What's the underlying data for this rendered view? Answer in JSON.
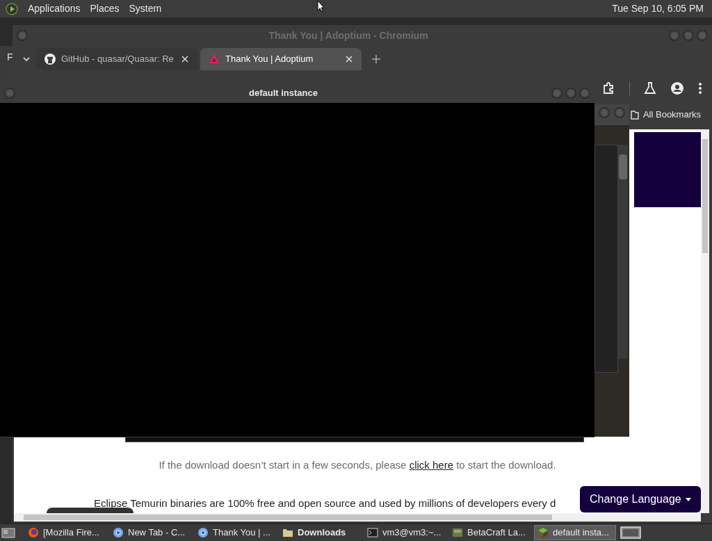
{
  "top_panel": {
    "menus": [
      "Applications",
      "Places",
      "System"
    ],
    "clock": "Tue Sep 10, 6:05 PM"
  },
  "background_window": {
    "text": "F"
  },
  "chromium": {
    "title": "Thank You | Adoptium - Chromium",
    "tabs": [
      {
        "label": "GitHub - quasar/Quasar: Re",
        "selected": false,
        "kind": "github"
      },
      {
        "label": "Thank You | Adoptium",
        "selected": true,
        "kind": "adoptium"
      }
    ],
    "bookmarks": "All Bookmarks",
    "page": {
      "notice_before": "If the download doesn’t start in a few seconds, please",
      "notice_link": "click here",
      "notice_after": "to start the download.",
      "intro": "Eclipse Temurin binaries are 100% free and open source and used by millions of developers every d",
      "language_button": "Change Language"
    }
  },
  "instance_window": {
    "title": "default instance"
  },
  "taskbar": [
    {
      "label": "[Mozilla Fire...",
      "kind": "firefox",
      "selected": false,
      "urgent": false
    },
    {
      "label": "New Tab - C...",
      "kind": "chromium",
      "selected": false,
      "urgent": false
    },
    {
      "label": "Thank You | ...",
      "kind": "chromium",
      "selected": false,
      "urgent": false
    },
    {
      "label": "Downloads",
      "kind": "folder",
      "selected": false,
      "urgent": true
    },
    {
      "label": "vm3@vm3:~...",
      "kind": "terminal",
      "selected": false,
      "urgent": false
    },
    {
      "label": "BetaCraft La...",
      "kind": "launcher",
      "selected": false,
      "urgent": false
    },
    {
      "label": "default insta...",
      "kind": "block",
      "selected": true,
      "urgent": false
    }
  ]
}
